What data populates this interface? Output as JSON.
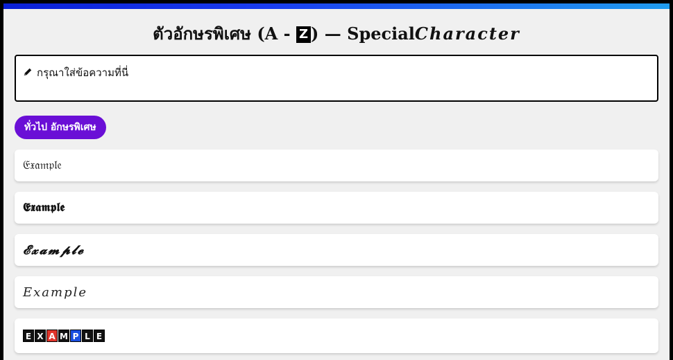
{
  "header": {
    "title_thai": "ตัวอักษรพิเศษ (A - ",
    "title_z": "Z",
    "title_mid": ") — Special",
    "title_script": "Character"
  },
  "input": {
    "placeholder": "กรุณาใส่ข้อความที่นี่"
  },
  "tabs": [
    {
      "label": "ทั่วไป อักษรพิเศษ"
    }
  ],
  "results": [
    {
      "text": "𝔈𝔵𝔞𝔪𝔭𝔩𝔢"
    },
    {
      "text": "𝕰𝖝𝖆𝖒𝖕𝖑𝖊"
    },
    {
      "text": "𝓔𝔁𝓪𝓶𝓹𝓵𝓮"
    },
    {
      "text": "𝐸𝑥𝑎𝑚𝑝𝑙𝑒"
    },
    {
      "boxes": [
        {
          "char": "E",
          "color": "#111111"
        },
        {
          "char": "X",
          "color": "#111111"
        },
        {
          "char": "A",
          "color": "#e0352b"
        },
        {
          "char": "M",
          "color": "#111111"
        },
        {
          "char": "P",
          "color": "#1a4fe0"
        },
        {
          "char": "L",
          "color": "#111111"
        },
        {
          "char": "E",
          "color": "#111111"
        }
      ]
    }
  ],
  "colors": {
    "accent": "#6a0fd6",
    "topbar_start": "#0a1fd6",
    "topbar_end": "#1f9df0"
  }
}
